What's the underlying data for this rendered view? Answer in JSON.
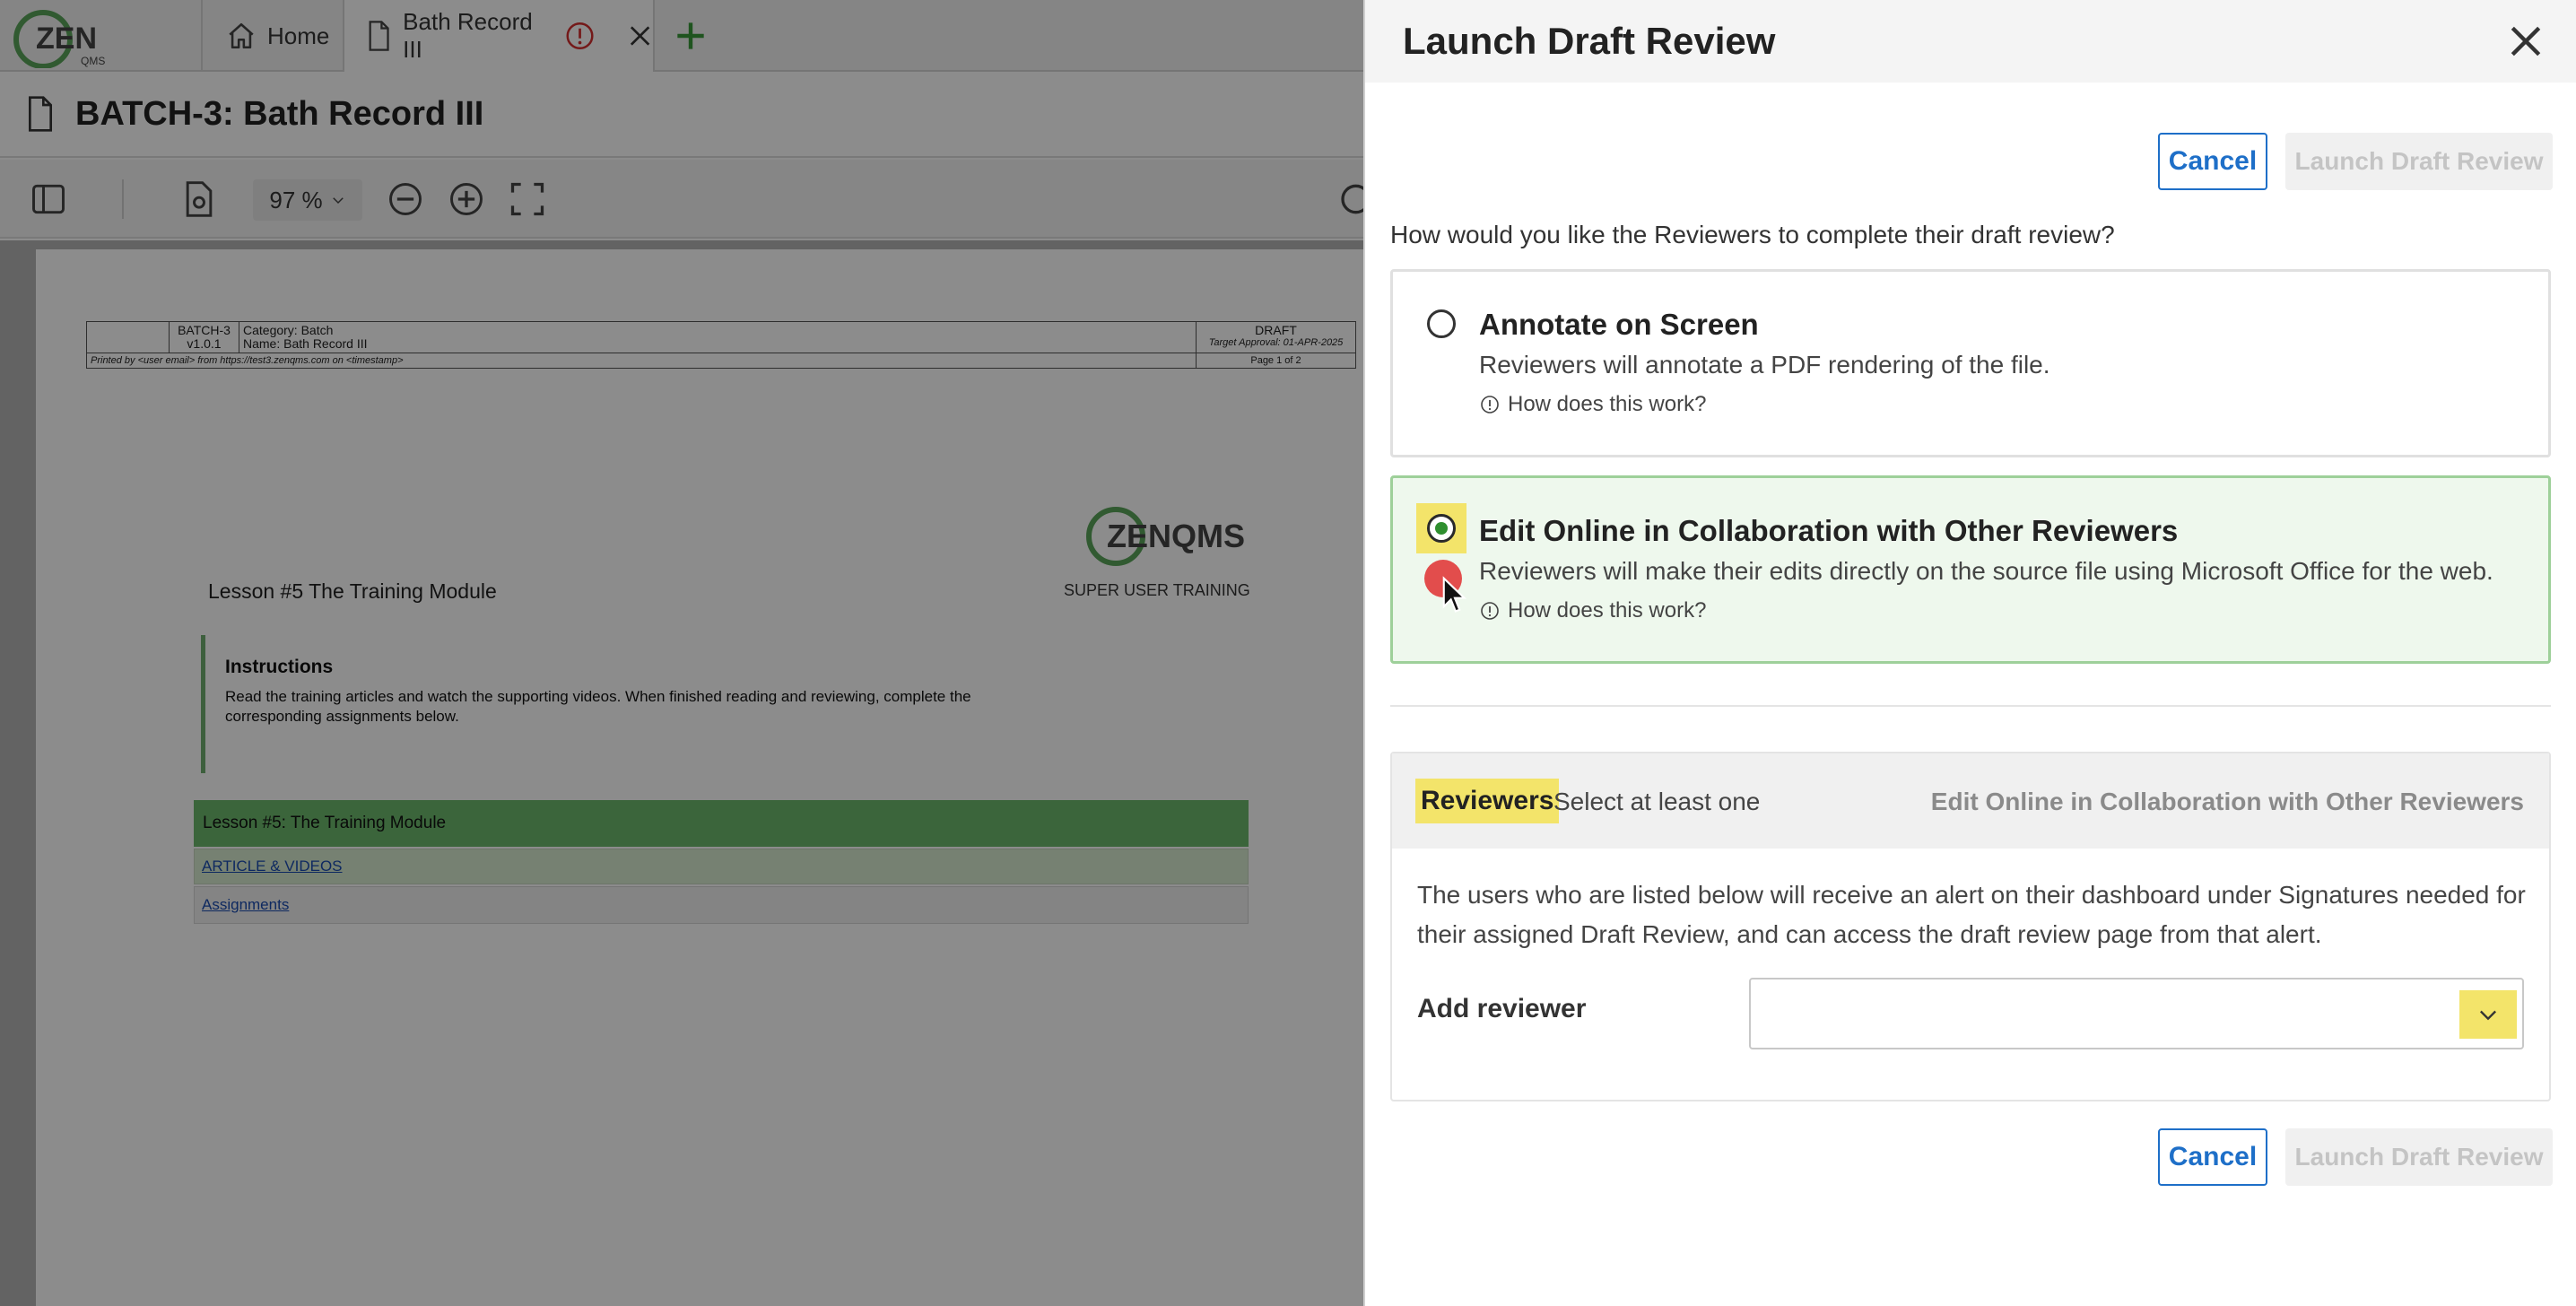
{
  "tabs": {
    "logo_text": "ZEN",
    "logo_sub": "QMS",
    "home_label": "Home",
    "doc_label": "Bath Record III"
  },
  "document": {
    "title": "BATCH-3: Bath Record III",
    "zoom": "97 %",
    "header": {
      "id": "BATCH-3",
      "version": "v1.0.1",
      "category_label": "Category:",
      "category": "Batch",
      "name_label": "Name:",
      "name": "Bath Record III",
      "status": "DRAFT",
      "target": "Target Approval: 01-APR-2025",
      "printed": "Printed by <user email> from https://test3.zenqms.com on <timestamp>",
      "page": "Page 1 of 2"
    },
    "logo_text": "ZENQMS",
    "logo_sub": "SUPER USER TRAINING",
    "lesson_title": "Lesson #5 The Training Module",
    "instructions_heading": "Instructions",
    "instructions_body": "Read the training articles and watch the supporting videos. When finished reading and reviewing, complete the corresponding assignments below.",
    "table_header": "Lesson #5: The Training Module",
    "link_articles": "ARTICLE & VIDEOS",
    "link_assignments": "Assignments"
  },
  "panel": {
    "title": "Launch Draft Review",
    "cancel_label": "Cancel",
    "launch_label": "Launch Draft Review",
    "question": "How would you like the Reviewers to complete their draft review?",
    "options": [
      {
        "title": "Annotate on Screen",
        "desc": "Reviewers will annotate a PDF rendering of the file.",
        "help": "How does this work?",
        "selected": false
      },
      {
        "title": "Edit Online in Collaboration with Other Reviewers",
        "desc": "Reviewers will make their edits directly on the source file using Microsoft Office for the web.",
        "help": "How does this work?",
        "selected": true
      }
    ],
    "reviewers": {
      "title": "Reviewers",
      "subtitle": "Select at least one",
      "mode": "Edit Online in Collaboration with Other Reviewers",
      "description": "The users who are listed below will receive an alert on their dashboard under Signatures needed for their assigned Draft Review, and can access the draft review page from that alert.",
      "add_label": "Add reviewer",
      "add_value": ""
    }
  },
  "colors": {
    "accent_blue": "#1e6fc8",
    "highlight_yellow": "#f3e46a",
    "selected_green": "#2f8f2f",
    "doc_green": "#6cb86c",
    "warning_red": "#d32f2f"
  },
  "icons": {
    "home": "home-icon",
    "document": "document-icon",
    "alert": "alert-icon",
    "close": "close-icon",
    "add": "plus-icon",
    "info": "info-icon",
    "chevron": "chevron-down-icon"
  }
}
